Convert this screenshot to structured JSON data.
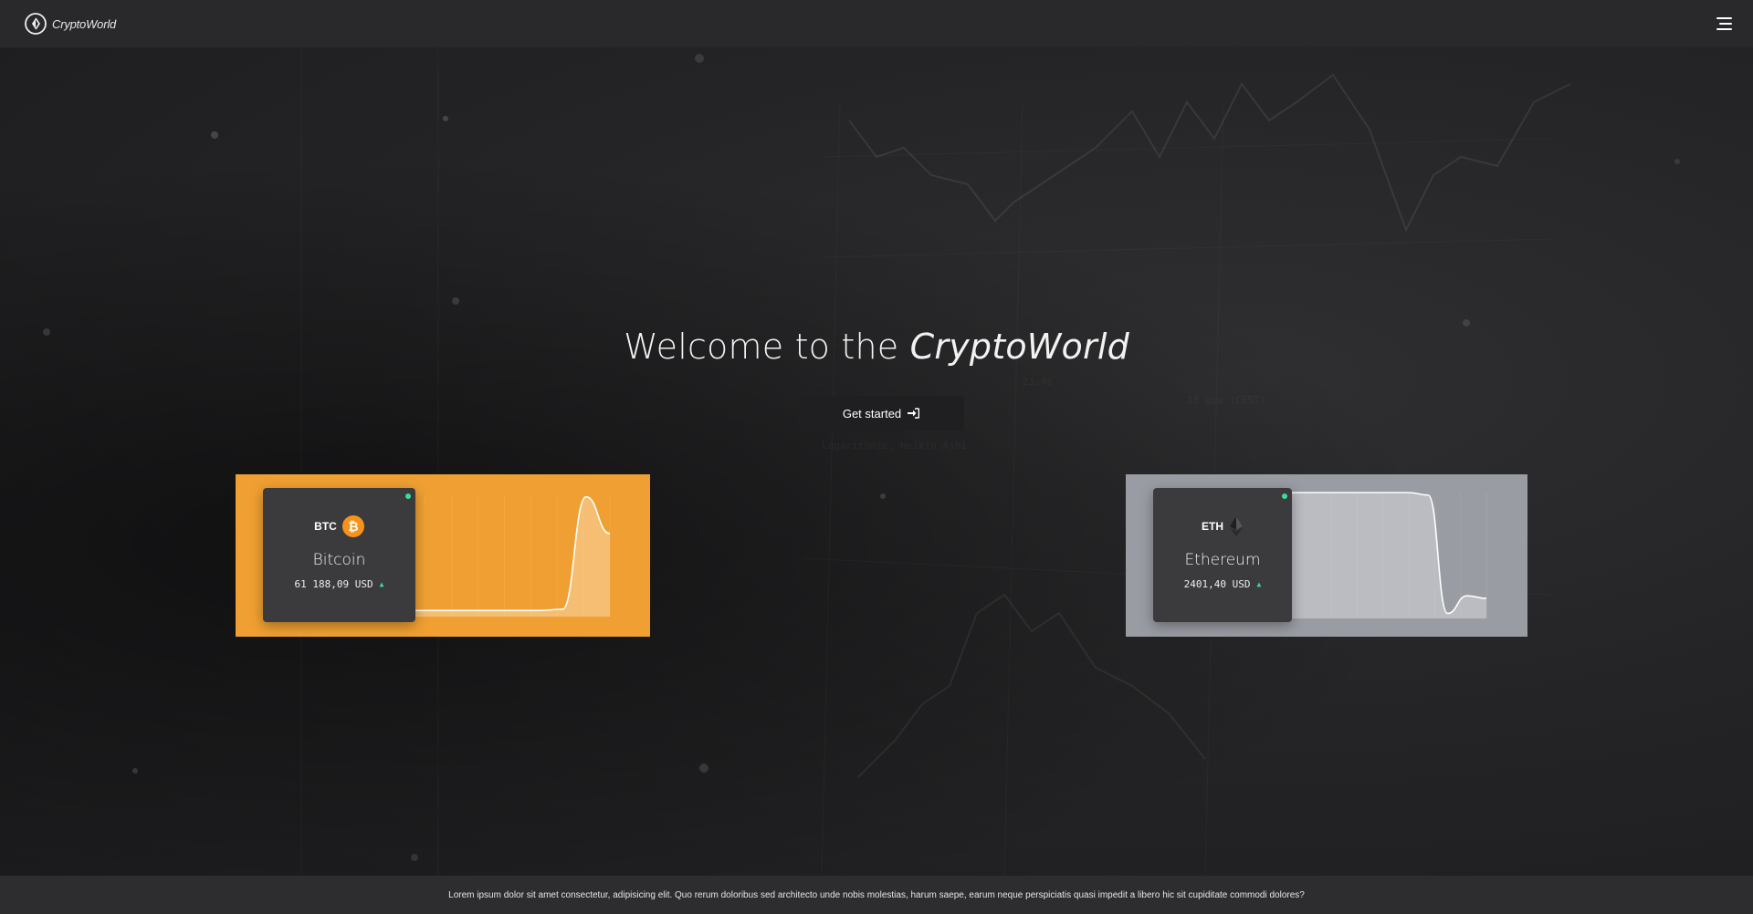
{
  "navbar": {
    "brand": "CryptoWorld",
    "logo_icon": "cryptoworld-logo-icon",
    "menu_icon": "hamburger-menu-icon"
  },
  "hero": {
    "title_prefix": "Welcome to the ",
    "title_emphasis": "CryptoWorld",
    "cta_label": "Get started",
    "cta_icon": "sign-in-icon"
  },
  "coins": [
    {
      "symbol": "BTC",
      "name": "Bitcoin",
      "price": "61 188,09 USD",
      "trend": "up",
      "icon": "bitcoin-icon",
      "accent_color": "#f0a032",
      "sparkline": [
        0.05,
        0.05,
        0.05,
        0.05,
        0.05,
        0.05,
        0.05,
        0.05,
        0.06,
        0.98,
        0.68
      ]
    },
    {
      "symbol": "ETH",
      "name": "Ethereum",
      "price": "2401,40 USD",
      "trend": "up",
      "icon": "ethereum-icon",
      "accent_color": "#9a9ca4",
      "sparkline": [
        1,
        1,
        1,
        1,
        1,
        1,
        1,
        1,
        1,
        0.98,
        0.04,
        0.18,
        0.16
      ]
    }
  ],
  "footer": {
    "text": "Lorem ipsum dolor sit amet consectetur, adipisicing elit. Quo rerum doloribus sed architecto unde nobis molestias, harum saepe, earum neque perspiciatis quasi impedit a libero hic sit cupiditate commodi dolores?"
  },
  "colors": {
    "navbar_bg": "#29292c",
    "card_bg": "#3b3b3e",
    "live_indicator": "#3ddc97",
    "footer_bg": "#2d2d30"
  }
}
